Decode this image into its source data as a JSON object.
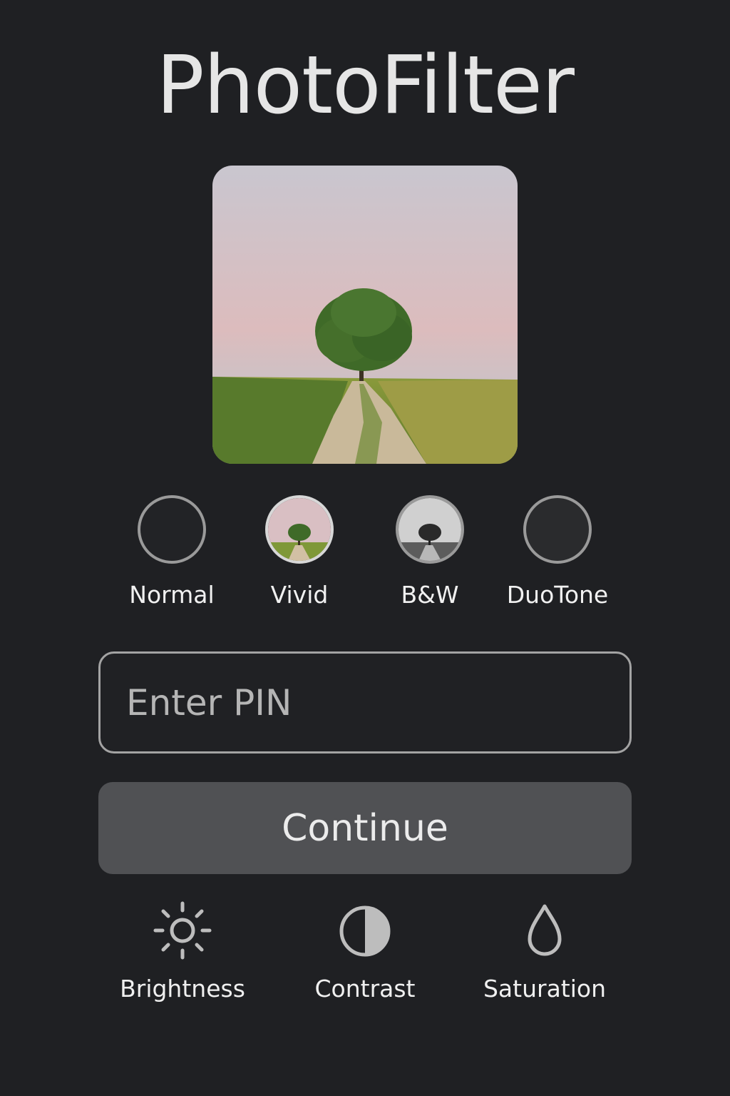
{
  "app": {
    "title": "PhotoFilter"
  },
  "preview": {
    "image": "landscape photo: lone tree beside dirt path through fields at dusk"
  },
  "filters": [
    {
      "label": "Normal",
      "selected": false
    },
    {
      "label": "Vivid",
      "selected": true
    },
    {
      "label": "B&W",
      "selected": false
    },
    {
      "label": "DuoTone",
      "selected": false
    }
  ],
  "pin_input": {
    "placeholder": "Enter PIN",
    "value": ""
  },
  "continue_button": {
    "label": "Continue"
  },
  "tools": [
    {
      "label": "Brightness",
      "icon": "sun-icon"
    },
    {
      "label": "Contrast",
      "icon": "contrast-icon"
    },
    {
      "label": "Saturation",
      "icon": "drop-icon"
    }
  ],
  "colors": {
    "background": "#1f2023",
    "button": "#505154",
    "text": "#f0f0f0",
    "border": "#a3a3a3"
  }
}
